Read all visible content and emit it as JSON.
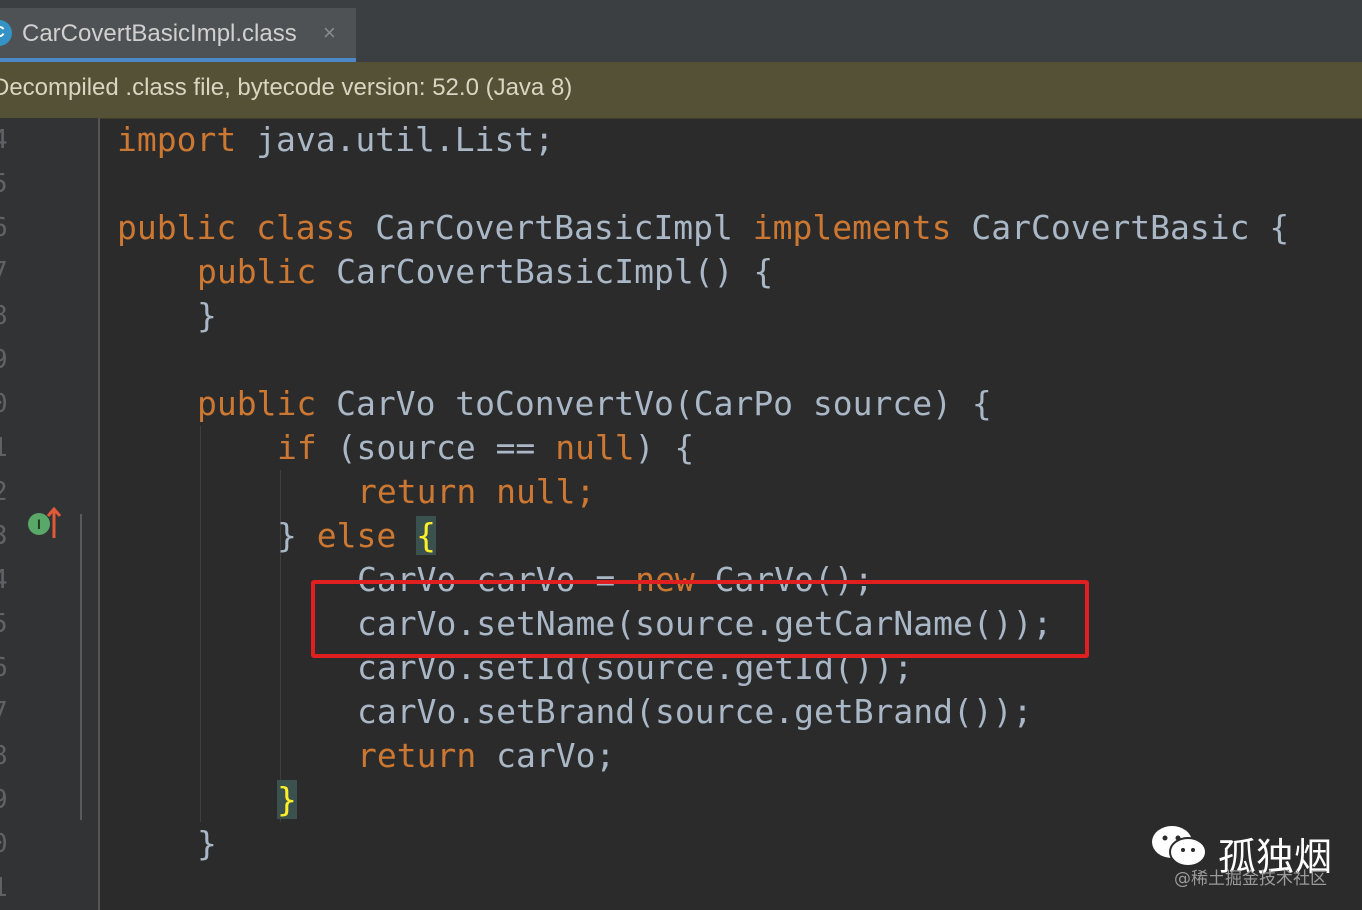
{
  "tab": {
    "icon_letter": "C",
    "label": "CarCovertBasicImpl.class",
    "close_glyph": "×"
  },
  "banner": {
    "text": "Decompiled .class file, bytecode version: 52.0 (Java 8)"
  },
  "gutter": {
    "line_numbers": [
      "4",
      "5",
      "6",
      "7",
      "8",
      "9",
      "0",
      "1",
      "2",
      "3",
      "4",
      "5",
      "6",
      "7",
      "8",
      "9",
      "0",
      "1"
    ],
    "implements_marker_letter": "I"
  },
  "code": [
    [
      "import",
      "java.util.List;"
    ],
    [],
    [
      "public class",
      "CarCovertBasicImpl",
      "implements",
      "CarCovertBasic {"
    ],
    [
      "public",
      "CarCovertBasicImpl() {"
    ],
    [
      "}"
    ],
    [],
    [
      "public",
      "CarVo toConvertVo(CarPo source) {"
    ],
    [
      "if",
      "(source ==",
      "null",
      ") {"
    ],
    [
      "return null;"
    ],
    [
      "}",
      "else",
      "{"
    ],
    [
      "CarVo carVo =",
      "new",
      "CarVo();"
    ],
    [
      "carVo.setName(source.getCarName());"
    ],
    [
      "carVo.setId(source.getId());"
    ],
    [
      "carVo.setBrand(source.getBrand());"
    ],
    [
      "return",
      "carVo;"
    ],
    [
      "}"
    ],
    [
      "}"
    ],
    []
  ],
  "watermark": {
    "name": "孤独烟",
    "source": "@稀土掘金技术社区"
  },
  "colors": {
    "keyword": "#cc7832",
    "text": "#a9b7c6",
    "background": "#2b2b2b",
    "highlight_box": "#e02020",
    "banner_bg": "#545137"
  },
  "icons": [
    "class-file-icon",
    "close-icon",
    "implements-gutter-icon",
    "go-to-super-arrow-icon",
    "wechat-logo-icon"
  ]
}
